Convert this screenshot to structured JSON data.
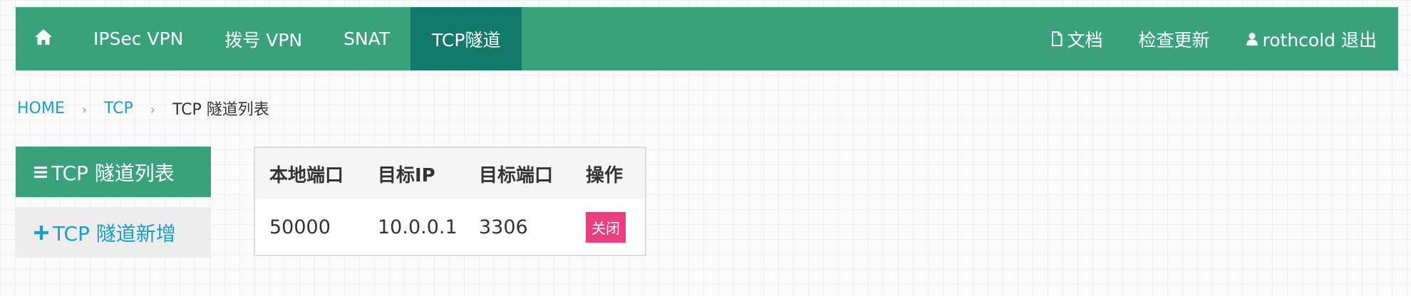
{
  "navbar": {
    "home_icon": "home-icon",
    "items": [
      {
        "label": "IPSec VPN"
      },
      {
        "label": "拨号 VPN"
      },
      {
        "label": "SNAT"
      },
      {
        "label": "TCP隧道",
        "active": true
      }
    ],
    "right": {
      "docs_icon": "document-icon",
      "docs_label": "文档",
      "update_label": "检查更新",
      "user_icon": "user-icon",
      "logout_label": "rothcold 退出"
    },
    "colors": {
      "background": "#3aa17d",
      "active": "#13796a"
    }
  },
  "breadcrumb": {
    "items": [
      "HOME",
      "TCP",
      "TCP 隧道列表"
    ],
    "separator": "›"
  },
  "sidebar": {
    "items": [
      {
        "icon": "list-icon",
        "label": "TCP 隧道列表",
        "active": true
      },
      {
        "icon": "plus-icon",
        "label": "TCP 隧道新增",
        "active": false
      }
    ]
  },
  "table": {
    "headers": [
      "本地端口",
      "目标IP",
      "目标端口",
      "操作"
    ],
    "rows": [
      {
        "local_port": "50000",
        "target_ip": "10.0.0.1",
        "target_port": "3306",
        "action": "关闭"
      }
    ],
    "colors": {
      "action_button": "#ea3f7e"
    }
  }
}
